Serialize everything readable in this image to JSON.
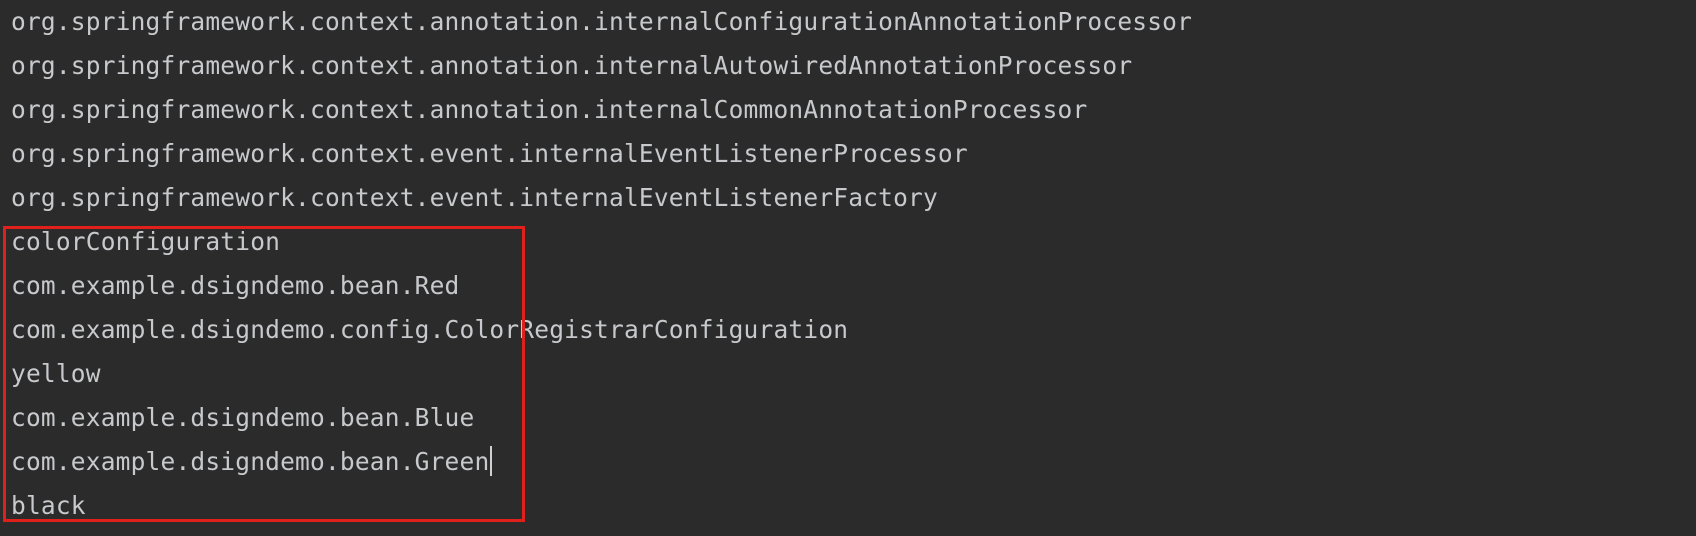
{
  "console": {
    "lines": [
      "org.springframework.context.annotation.internalConfigurationAnnotationProcessor",
      "org.springframework.context.annotation.internalAutowiredAnnotationProcessor",
      "org.springframework.context.annotation.internalCommonAnnotationProcessor",
      "org.springframework.context.event.internalEventListenerProcessor",
      "org.springframework.context.event.internalEventListenerFactory",
      "colorConfiguration",
      "com.example.dsigndemo.bean.Red",
      "com.example.dsigndemo.config.ColorRegistrarConfiguration",
      "yellow",
      "com.example.dsigndemo.bean.Blue",
      "com.example.dsigndemo.bean.Green",
      "black"
    ]
  },
  "colors": {
    "background": "#2b2b2b",
    "text": "#c7c9cc",
    "highlight_border": "#e0201b"
  }
}
